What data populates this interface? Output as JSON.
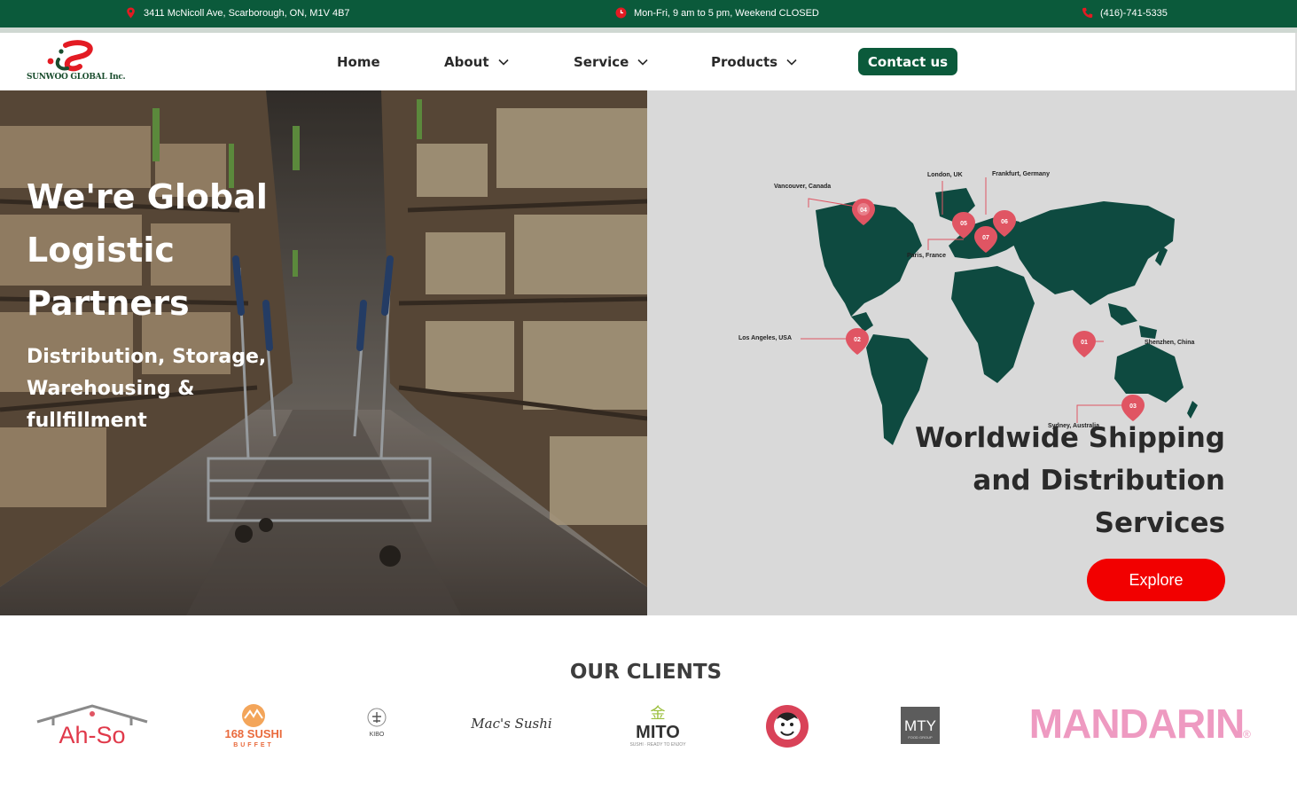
{
  "topbar": {
    "address": "3411 McNicoll Ave, Scarborough, ON, M1V 4B7",
    "hours": "Mon-Fri, 9 am to 5 pm, Weekend CLOSED",
    "phone": "(416)-741-5335",
    "icons": [
      "location-pin-icon",
      "clock-icon",
      "phone-icon"
    ],
    "accent_color": "#e31b23"
  },
  "header": {
    "logo_text": "SUNWOO GLOBAL Inc.",
    "nav": {
      "home": "Home",
      "about": "About",
      "service": "Service",
      "products": "Products"
    },
    "contact_label": "Contact us"
  },
  "hero": {
    "title_lines": [
      "We're Global",
      "Logistic",
      "Partners"
    ],
    "subtitle_lines": [
      "Distribution, Storage,",
      "Warehousing &",
      "fullfillment"
    ],
    "right_title_lines": [
      "Worldwide Shipping",
      "and Distribution",
      "Services"
    ],
    "explore_label": "Explore",
    "map_pins": [
      {
        "num": "01",
        "label": "Shenzhen, China"
      },
      {
        "num": "02",
        "label": "Los Angeles, USA"
      },
      {
        "num": "03",
        "label": "Sydney, Australia"
      },
      {
        "num": "04",
        "label": "Vancouver, Canada"
      },
      {
        "num": "05",
        "label": "London, UK"
      },
      {
        "num": "06",
        "label": "Frankfurt, Germany"
      },
      {
        "num": "07",
        "label": "Paris, France"
      }
    ]
  },
  "clients": {
    "title": "OUR CLIENTS",
    "logos": {
      "ahso": "Ah-So",
      "sushi168": "168 SUSHI",
      "sushi168_sub": "BUFFET",
      "kibo": "KIBO",
      "macs": "Mac's Sushi",
      "mito": "MITO",
      "mito_cjk": "金",
      "mito_sub": "SUSHI · READY TO ENJOY",
      "mty": "MTY",
      "mty_sub": "FOOD GROUP",
      "mandarin": "MANDARIN",
      "mandarin_mark": "®"
    }
  },
  "colors": {
    "brand_green": "#0b5a3b",
    "explore_red": "#f20000",
    "map_green": "#0e4a40",
    "pin_red": "#e05563"
  }
}
